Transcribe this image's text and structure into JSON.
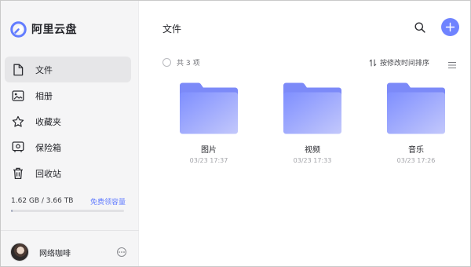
{
  "app": {
    "name": "阿里云盘",
    "accent_color": "#637dff"
  },
  "sidebar": {
    "items": [
      {
        "label": "文件",
        "icon": "file-icon",
        "active": true
      },
      {
        "label": "相册",
        "icon": "photo-album-icon",
        "active": false
      },
      {
        "label": "收藏夹",
        "icon": "star-icon",
        "active": false
      },
      {
        "label": "保险箱",
        "icon": "safe-box-icon",
        "active": false
      },
      {
        "label": "回收站",
        "icon": "trash-icon",
        "active": false
      }
    ],
    "storage": {
      "used_text": "1.62 GB / 3.66 TB",
      "link_label": "免费领容量",
      "used_fraction": 0.00043
    },
    "user": {
      "name": "网络咖啡",
      "more_icon": "more-dots-icon"
    }
  },
  "main": {
    "title": "文件",
    "search_icon": "search-icon",
    "add_icon": "plus-icon",
    "count_text": "共 3 项",
    "sort_label": "按修改时间排序",
    "sort_icon": "sort-arrows-icon",
    "view_icon": "list-view-icon",
    "files": [
      {
        "name": "图片",
        "date": "03/23 17:37",
        "icon": "folder-icon"
      },
      {
        "name": "视频",
        "date": "03/23 17:33",
        "icon": "folder-icon"
      },
      {
        "name": "音乐",
        "date": "03/23 17:26",
        "icon": "folder-icon"
      }
    ]
  }
}
